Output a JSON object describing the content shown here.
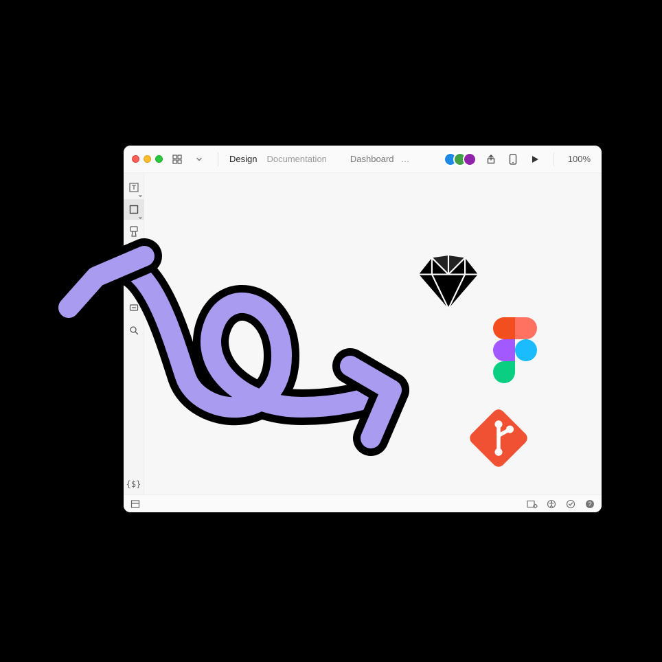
{
  "window": {
    "traffic": [
      "close",
      "minimize",
      "zoom"
    ],
    "grid_menu_label": "Apps",
    "tabs": [
      {
        "id": "design",
        "label": "Design",
        "active": true
      },
      {
        "id": "documentation",
        "label": "Documentation",
        "active": false
      }
    ],
    "page_label": "Dashboard",
    "more_label": "…",
    "collaborators": [
      {
        "name": "User 1",
        "color": "#1e88e5"
      },
      {
        "name": "User 2",
        "color": "#43a047"
      },
      {
        "name": "User 3",
        "color": "#8e24aa"
      }
    ],
    "share_icon": "share-icon",
    "preview_device_icon": "device-icon",
    "play_icon": "play-icon",
    "zoom_label": "100%"
  },
  "sidebar": {
    "tools": [
      {
        "id": "text",
        "name": "text-tool-icon",
        "corner": true
      },
      {
        "id": "rect",
        "name": "rectangle-tool-icon",
        "corner": true,
        "active": true
      },
      {
        "id": "badge",
        "name": "component-tool-icon",
        "corner": true
      },
      {
        "id": "layers",
        "name": "layers-tool-icon",
        "corner": false
      }
    ],
    "secondary": [
      {
        "id": "bolt",
        "name": "bolt-icon"
      },
      {
        "id": "comment",
        "name": "comment-icon"
      },
      {
        "id": "search",
        "name": "search-icon"
      }
    ],
    "token_label": "{$}"
  },
  "canvas": {
    "items": [
      {
        "id": "sketch",
        "name": "sketch-logo"
      },
      {
        "id": "figma",
        "name": "figma-logo"
      },
      {
        "id": "git",
        "name": "git-logo"
      }
    ]
  },
  "statusbar": {
    "left_icon": "panel-icon",
    "right_icons": [
      "settings-chip-icon",
      "accessibility-icon",
      "check-icon",
      "help-icon"
    ]
  },
  "overlay": {
    "name": "hand-drawn-arrow",
    "color": "#a89bf0",
    "stroke": "#000000"
  }
}
